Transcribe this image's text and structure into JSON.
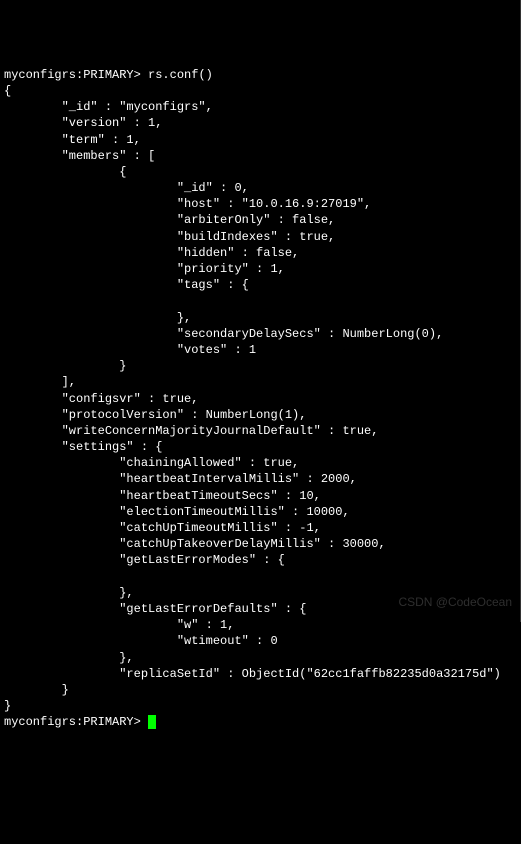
{
  "terminal": {
    "prompt1": "myconfigrs:PRIMARY> ",
    "command1": "rs.conf()",
    "output": "{\n        \"_id\" : \"myconfigrs\",\n        \"version\" : 1,\n        \"term\" : 1,\n        \"members\" : [\n                {\n                        \"_id\" : 0,\n                        \"host\" : \"10.0.16.9:27019\",\n                        \"arbiterOnly\" : false,\n                        \"buildIndexes\" : true,\n                        \"hidden\" : false,\n                        \"priority\" : 1,\n                        \"tags\" : {\n\n                        },\n                        \"secondaryDelaySecs\" : NumberLong(0),\n                        \"votes\" : 1\n                }\n        ],\n        \"configsvr\" : true,\n        \"protocolVersion\" : NumberLong(1),\n        \"writeConcernMajorityJournalDefault\" : true,\n        \"settings\" : {\n                \"chainingAllowed\" : true,\n                \"heartbeatIntervalMillis\" : 2000,\n                \"heartbeatTimeoutSecs\" : 10,\n                \"electionTimeoutMillis\" : 10000,\n                \"catchUpTimeoutMillis\" : -1,\n                \"catchUpTakeoverDelayMillis\" : 30000,\n                \"getLastErrorModes\" : {\n\n                },\n                \"getLastErrorDefaults\" : {\n                        \"w\" : 1,\n                        \"wtimeout\" : 0\n                },\n                \"replicaSetId\" : ObjectId(\"62cc1faffb82235d0a32175d\")\n        }\n}",
    "prompt2": "myconfigrs:PRIMARY> "
  },
  "watermark": "CSDN @CodeOcean",
  "chart_data": {
    "type": "table",
    "title": "rs.conf() output",
    "data": {
      "_id": "myconfigrs",
      "version": 1,
      "term": 1,
      "members": [
        {
          "_id": 0,
          "host": "10.0.16.9:27019",
          "arbiterOnly": false,
          "buildIndexes": true,
          "hidden": false,
          "priority": 1,
          "tags": {},
          "secondaryDelaySecs": "NumberLong(0)",
          "votes": 1
        }
      ],
      "configsvr": true,
      "protocolVersion": "NumberLong(1)",
      "writeConcernMajorityJournalDefault": true,
      "settings": {
        "chainingAllowed": true,
        "heartbeatIntervalMillis": 2000,
        "heartbeatTimeoutSecs": 10,
        "electionTimeoutMillis": 10000,
        "catchUpTimeoutMillis": -1,
        "catchUpTakeoverDelayMillis": 30000,
        "getLastErrorModes": {},
        "getLastErrorDefaults": {
          "w": 1,
          "wtimeout": 0
        },
        "replicaSetId": "ObjectId(\"62cc1faffb82235d0a32175d\")"
      }
    }
  }
}
